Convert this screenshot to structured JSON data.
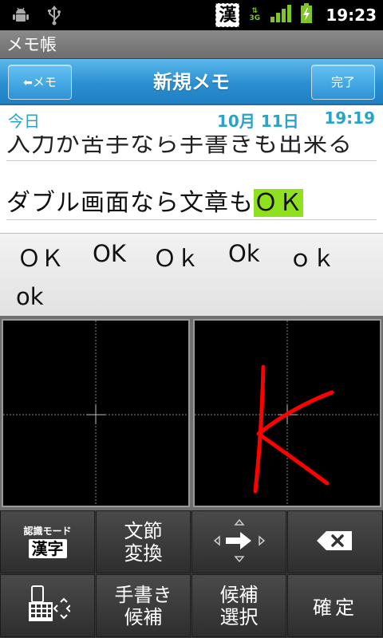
{
  "status_bar": {
    "icons": [
      "android-debug-icon",
      "usb-icon",
      "kanji-input-icon",
      "3g-data-icon",
      "signal-icon",
      "battery-charging-icon"
    ],
    "kanji_indicator": "漢",
    "network": "3G",
    "time": "19:23"
  },
  "app": {
    "title": "メモ帳"
  },
  "header": {
    "back_label": "メモ",
    "title": "新規メモ",
    "done_label": "完了"
  },
  "memo": {
    "date_today": "今日",
    "date_md": "10月 11日",
    "date_time": "19:19",
    "line1": "入力が苦手なら手書きも出来る",
    "line2_prefix": "ダブル画面なら文章も",
    "line2_highlight": "ＯＫ"
  },
  "candidates": [
    "ＯＫ",
    "OK",
    "Ｏｋ",
    "Ok",
    "ｏｋ",
    "ok"
  ],
  "keypad": {
    "mode_small": "認識モード",
    "mode_big": "漢字",
    "bunsetsu": [
      "文節",
      "変換"
    ],
    "tegaki": [
      "手書き",
      "候補"
    ],
    "kouho": [
      "候補",
      "選択"
    ],
    "confirm": "確定"
  },
  "colors": {
    "accent": "#2aa3c8",
    "header_blue": "#2a8fd1",
    "highlight": "#8fe01e",
    "stroke": "#ff0000"
  }
}
